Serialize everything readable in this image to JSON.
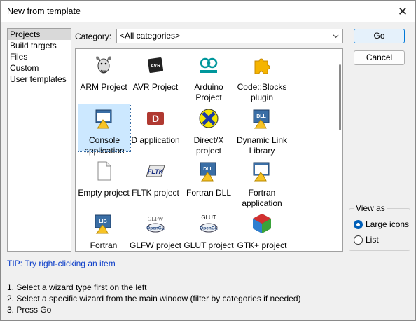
{
  "window": {
    "title": "New from template",
    "close_label": "✕"
  },
  "sidebar": {
    "items": [
      {
        "label": "Projects"
      },
      {
        "label": "Build targets"
      },
      {
        "label": "Files"
      },
      {
        "label": "Custom"
      },
      {
        "label": "User templates"
      }
    ]
  },
  "category": {
    "label": "Category:",
    "value": "<All categories>"
  },
  "templates": [
    {
      "label": "ARM Project",
      "icon": "gnu-icon"
    },
    {
      "label": "AVR Project",
      "icon": "avr-icon"
    },
    {
      "label": "Arduino Project",
      "icon": "arduino-icon"
    },
    {
      "label": "Code::Blocks plugin",
      "icon": "puzzle-icon"
    },
    {
      "label": "Console application",
      "icon": "console-app-icon",
      "selected": true
    },
    {
      "label": "D application",
      "icon": "d-lang-icon"
    },
    {
      "label": "Direct/X project",
      "icon": "directx-icon"
    },
    {
      "label": "Dynamic Link Library",
      "icon": "dll-icon"
    },
    {
      "label": "Empty project",
      "icon": "empty-file-icon"
    },
    {
      "label": "FLTK project",
      "icon": "fltk-icon"
    },
    {
      "label": "Fortran DLL",
      "icon": "fortran-dll-icon"
    },
    {
      "label": "Fortran application",
      "icon": "fortran-app-icon"
    },
    {
      "label": "Fortran library",
      "icon": "fortran-lib-icon"
    },
    {
      "label": "GLFW project",
      "icon": "glfw-icon"
    },
    {
      "label": "GLUT project",
      "icon": "glut-icon"
    },
    {
      "label": "GTK+ project",
      "icon": "gtk-icon"
    }
  ],
  "buttons": {
    "go": "Go",
    "cancel": "Cancel"
  },
  "view_as": {
    "legend": "View as",
    "large_icons": "Large icons",
    "list": "List",
    "selected": "large_icons"
  },
  "tip": "TIP: Try right-clicking an item",
  "instructions": [
    "1. Select a wizard type first on the left",
    "2. Select a specific wizard from the main window (filter by categories if needed)",
    "3. Press Go"
  ],
  "colors": {
    "accent": "#0078d7",
    "tip": "#0a3cc8",
    "selection": "#cce8ff"
  }
}
